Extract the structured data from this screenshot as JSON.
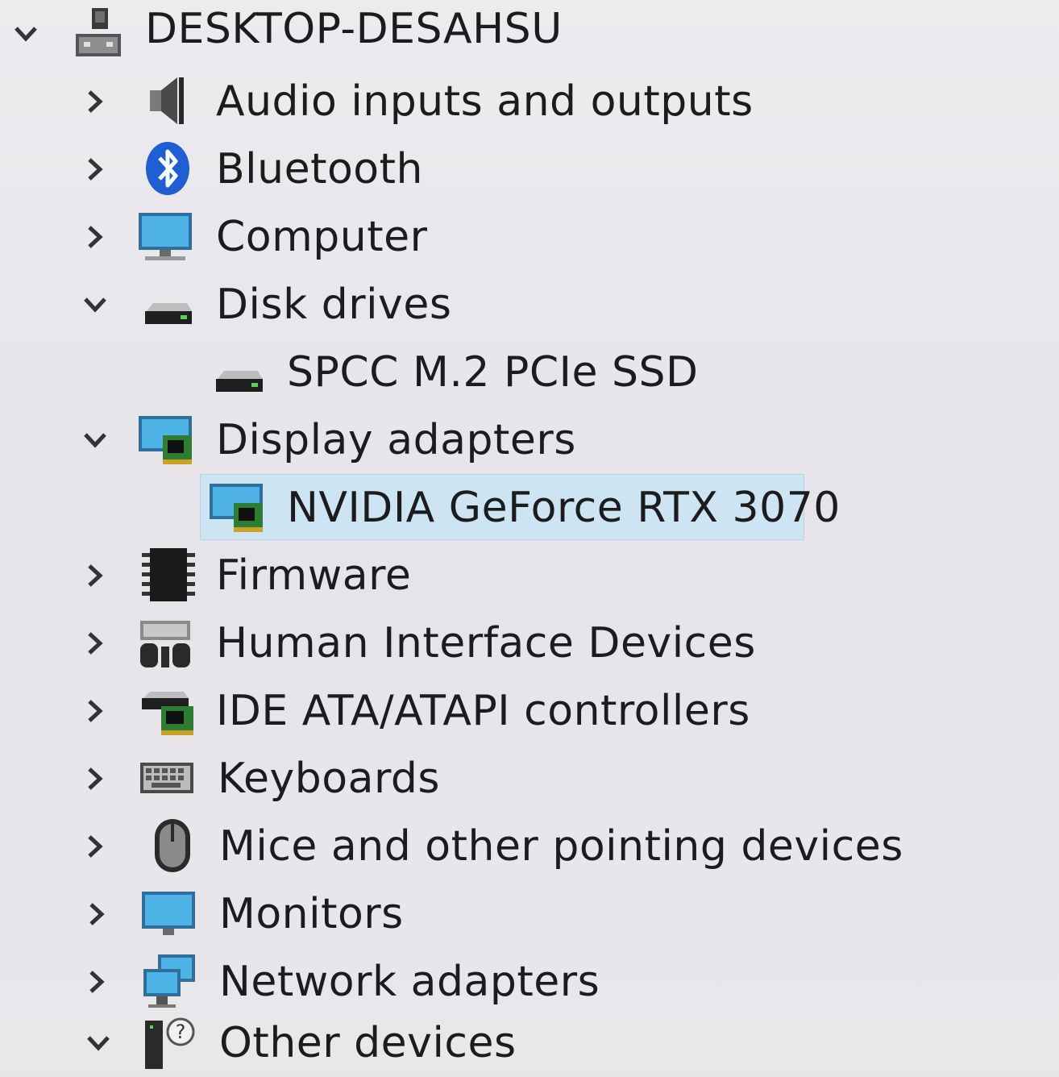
{
  "root": {
    "label": "DESKTOP-DESAHSU",
    "expanded": true
  },
  "categories": [
    {
      "label": "Audio inputs and outputs",
      "icon": "speaker-icon",
      "expanded": false
    },
    {
      "label": "Bluetooth",
      "icon": "bluetooth-icon",
      "expanded": false
    },
    {
      "label": "Computer",
      "icon": "computer-icon",
      "expanded": false
    },
    {
      "label": "Disk drives",
      "icon": "disk-drive-icon",
      "expanded": true
    },
    {
      "label": "SPCC M.2 PCIe SSD",
      "icon": "disk-drive-icon",
      "child": true
    },
    {
      "label": "Display adapters",
      "icon": "display-adapter-icon",
      "expanded": true
    },
    {
      "label": "NVIDIA GeForce RTX 3070",
      "icon": "display-adapter-icon",
      "child": true,
      "selected": true
    },
    {
      "label": "Firmware",
      "icon": "chip-icon",
      "expanded": false
    },
    {
      "label": "Human Interface Devices",
      "icon": "hid-icon",
      "expanded": false
    },
    {
      "label": "IDE ATA/ATAPI controllers",
      "icon": "ide-controller-icon",
      "expanded": false
    },
    {
      "label": "Keyboards",
      "icon": "keyboard-icon",
      "expanded": false
    },
    {
      "label": "Mice and other pointing devices",
      "icon": "mouse-icon",
      "expanded": false
    },
    {
      "label": "Monitors",
      "icon": "monitor-icon",
      "expanded": false
    },
    {
      "label": "Network adapters",
      "icon": "network-icon",
      "expanded": false
    },
    {
      "label": "Other devices",
      "icon": "unknown-device-icon",
      "expanded": true
    }
  ],
  "colors": {
    "background": "#e9e6ea",
    "text": "#1c1c1f",
    "selection": "#cde4f3",
    "icon_blue": "#3d97d6",
    "bluetooth_blue": "#1f5fd1"
  }
}
